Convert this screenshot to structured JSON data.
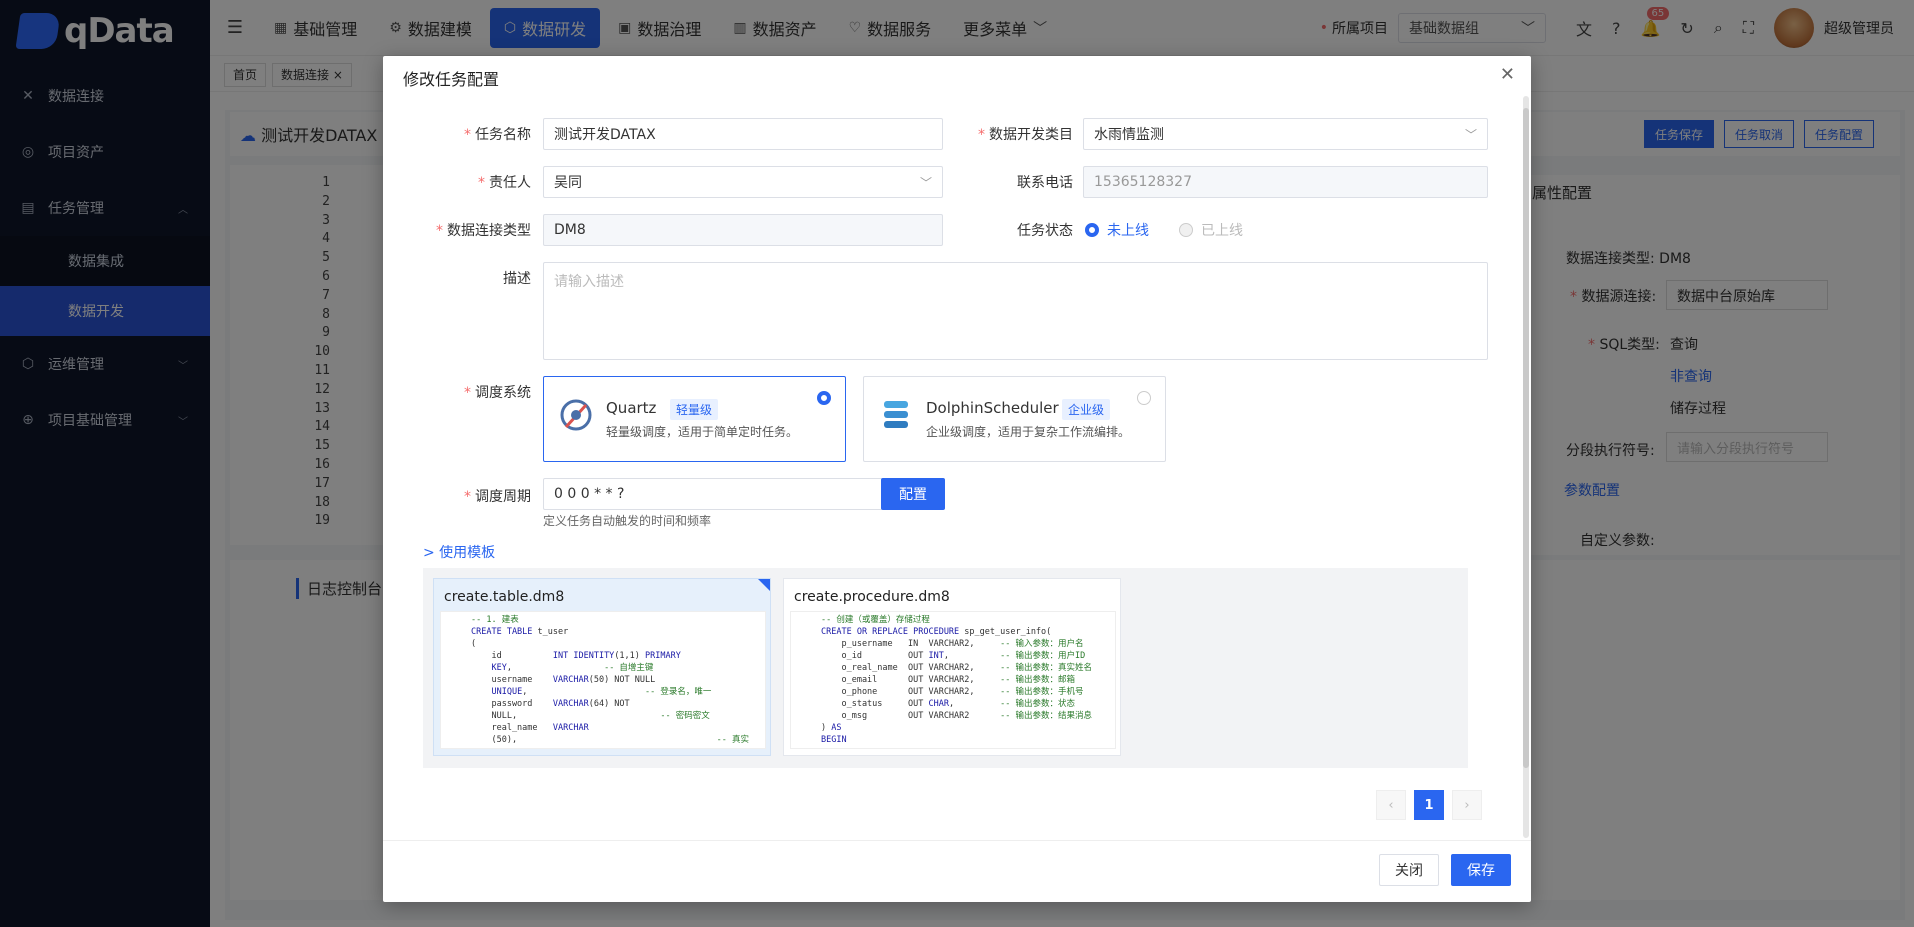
{
  "app": {
    "logo_text": "qData"
  },
  "sidebar": {
    "items": [
      {
        "label": "数据连接",
        "icon": "link-icon"
      },
      {
        "label": "项目资产",
        "icon": "asset-icon"
      },
      {
        "label": "任务管理",
        "icon": "task-icon",
        "expanded": true
      },
      {
        "label": "运维管理",
        "icon": "ops-icon"
      },
      {
        "label": "项目基础管理",
        "icon": "base-icon"
      }
    ],
    "subitems": [
      {
        "label": "数据集成"
      },
      {
        "label": "数据开发",
        "active": true
      }
    ]
  },
  "topnav": {
    "items": [
      {
        "label": "基础管理"
      },
      {
        "label": "数据建模"
      },
      {
        "label": "数据研发",
        "active": true
      },
      {
        "label": "数据治理"
      },
      {
        "label": "数据资产"
      },
      {
        "label": "数据服务"
      },
      {
        "label": "更多菜单"
      }
    ],
    "project_label": "所属项目",
    "project_value": "基础数据组",
    "notification_count": "65",
    "user_name": "超级管理员"
  },
  "tags": [
    "首页",
    "数据连接 ×"
  ],
  "background": {
    "page_title": "测试开发DATAX",
    "buttons": [
      "任务保存",
      "任务取消",
      "任务配置"
    ],
    "line_numbers": [
      "1",
      "2",
      "3",
      "4",
      "5",
      "6",
      "7",
      "8",
      "9",
      "10",
      "11",
      "12",
      "13",
      "14",
      "15",
      "16",
      "17",
      "18",
      "19"
    ],
    "props": {
      "title": "属性配置",
      "conn_type_label": "数据连接类型:",
      "conn_type_value": "DM8",
      "source_label": "数据源连接:",
      "source_value": "数据中台原始库",
      "sql_type_label": "SQL类型:",
      "sql_opts": [
        "查询",
        "非查询",
        "储存过程"
      ],
      "sep_label": "分段执行符号:",
      "sep_placeholder": "请输入分段执行符号",
      "param_title": "参数配置",
      "custom_param": "自定义参数:"
    },
    "log_title": "日志控制台"
  },
  "modal": {
    "title": "修改任务配置",
    "fields": {
      "task_name_label": "任务名称",
      "task_name_value": "测试开发DATAX",
      "category_label": "数据开发类目",
      "category_value": "水雨情监测",
      "owner_label": "责任人",
      "owner_value": "吴同",
      "phone_label": "联系电话",
      "phone_value": "15365128327",
      "conn_type_label": "数据连接类型",
      "conn_type_value": "DM8",
      "status_label": "任务状态",
      "status_opt_off": "未上线",
      "status_opt_on": "已上线",
      "desc_label": "描述",
      "desc_placeholder": "请输入描述",
      "scheduler_label": "调度系统",
      "cron_label": "调度周期",
      "cron_value": "0 0 0 * * ?",
      "cron_button": "配置",
      "cron_hint": "定义任务自动触发的时间和频率"
    },
    "schedulers": [
      {
        "name": "Quartz",
        "level": "轻量级",
        "desc": "轻量级调度，适用于简单定时任务。",
        "selected": true,
        "icon": "quartz-icon"
      },
      {
        "name": "DolphinScheduler",
        "level": "企业级",
        "desc": "企业级调度，适用于复杂工作流编排。",
        "selected": false,
        "icon": "dolphinscheduler-icon"
      }
    ],
    "template_link": "> 使用模板",
    "templates": [
      {
        "name": "create.table.dm8",
        "selected": true
      },
      {
        "name": "create.procedure.dm8",
        "selected": false
      }
    ],
    "pager": {
      "prev": "‹",
      "current": "1",
      "next": "›"
    },
    "footer": {
      "close": "关闭",
      "save": "保存"
    }
  }
}
